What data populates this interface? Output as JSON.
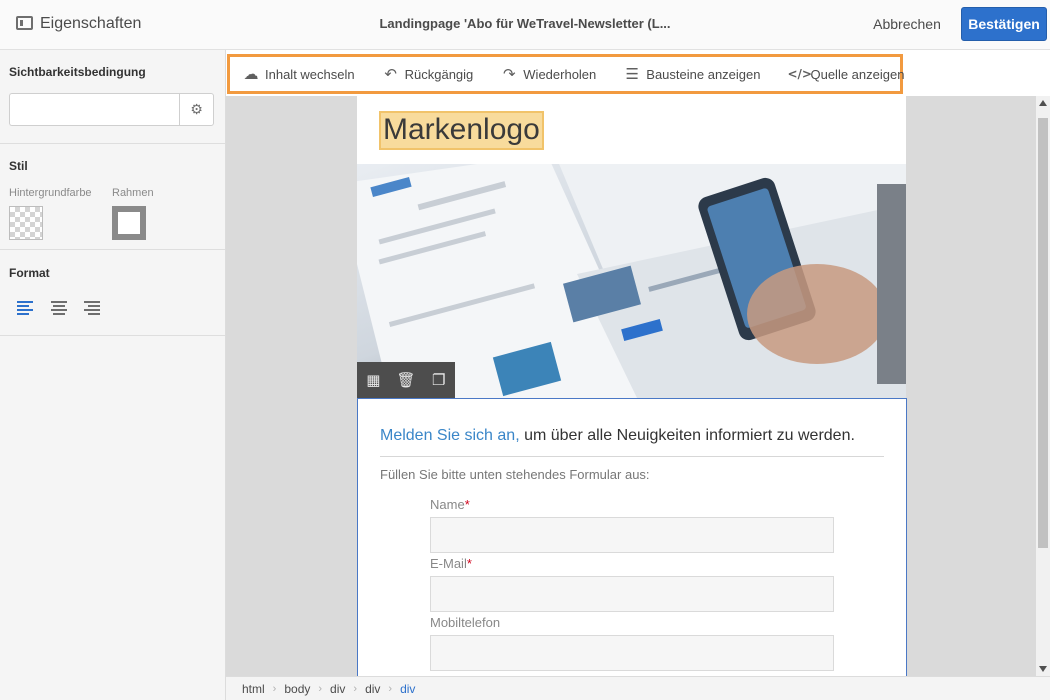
{
  "header": {
    "panel_title": "Eigenschaften",
    "document_title": "Landingpage 'Abo für WeTravel-Newsletter (L...",
    "cancel_label": "Abbrechen",
    "confirm_label": "Bestätigen"
  },
  "left_panel": {
    "visibility": {
      "title": "Sichtbarkeitsbedingung",
      "value": ""
    },
    "style": {
      "title": "Stil",
      "background_label": "Hintergrundfarbe",
      "border_label": "Rahmen"
    },
    "format": {
      "title": "Format",
      "alignments": [
        "left",
        "center",
        "right"
      ],
      "active": "left"
    }
  },
  "toolbar": {
    "items": [
      {
        "label": "Inhalt wechseln",
        "icon": "cloud-upload-icon"
      },
      {
        "label": "Rückgängig",
        "icon": "undo-icon"
      },
      {
        "label": "Wiederholen",
        "icon": "redo-icon"
      },
      {
        "label": "Bausteine anzeigen",
        "icon": "list-icon"
      },
      {
        "label": "Quelle anzeigen",
        "icon": "code-icon"
      }
    ]
  },
  "page": {
    "logo_text": "Markenlogo",
    "block_tools": [
      "layout-icon",
      "trash-icon",
      "copy-icon"
    ],
    "form": {
      "headline_link": "Melden Sie sich an,",
      "headline_rest": " um über alle Neuigkeiten informiert zu werden.",
      "intro": "Füllen Sie bitte unten stehendes Formular aus:",
      "fields": [
        {
          "label": "Name",
          "required": "*",
          "value": ""
        },
        {
          "label": "E-Mail",
          "required": "*",
          "value": ""
        },
        {
          "label": "Mobiltelefon",
          "required": "",
          "value": ""
        }
      ]
    }
  },
  "breadcrumb": [
    "html",
    "body",
    "div",
    "div",
    "div"
  ],
  "colors": {
    "accent": "#2d71cc",
    "highlight": "#f29a3f",
    "required": "#d0021b"
  }
}
